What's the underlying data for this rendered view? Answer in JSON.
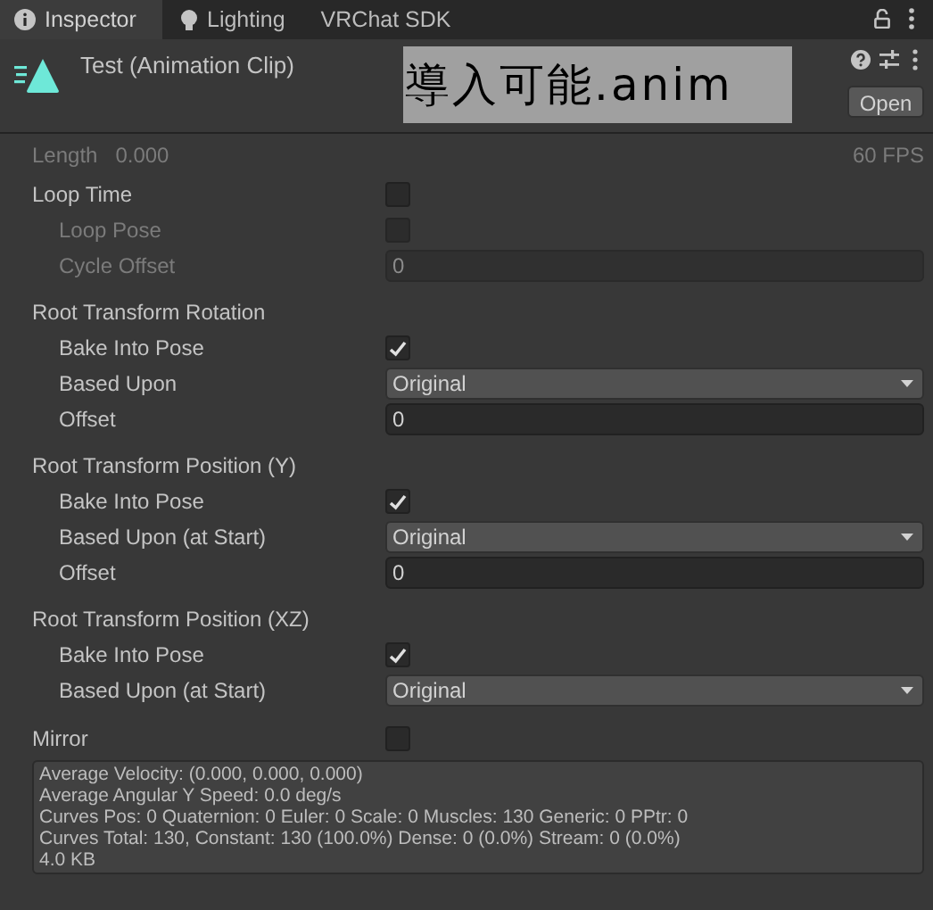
{
  "tabs": [
    {
      "label": "Inspector",
      "selected": true
    },
    {
      "label": "Lighting",
      "selected": false
    },
    {
      "label": "VRChat SDK",
      "selected": false
    }
  ],
  "header": {
    "title": "Test (Animation Clip)",
    "overlay_label": "導入可能.anim",
    "open_button": "Open"
  },
  "length": {
    "label": "Length",
    "value": "0.000",
    "fps": "60 FPS"
  },
  "properties": [
    {
      "kind": "checkbox",
      "label": "Loop Time",
      "checked": false,
      "disabled": false,
      "children": [
        {
          "kind": "checkbox",
          "label": "Loop Pose",
          "checked": false,
          "disabled": true
        },
        {
          "kind": "field",
          "label": "Cycle Offset",
          "value": "0",
          "disabled": true
        }
      ]
    },
    {
      "kind": "group",
      "label": "Root Transform Rotation",
      "disabled": false,
      "children": [
        {
          "kind": "checkbox",
          "label": "Bake Into Pose",
          "checked": true,
          "disabled": false
        },
        {
          "kind": "dropdown",
          "label": "Based Upon",
          "value": "Original",
          "disabled": false
        },
        {
          "kind": "field",
          "label": "Offset",
          "value": "0",
          "disabled": false
        }
      ]
    },
    {
      "kind": "group",
      "label": "Root Transform Position (Y)",
      "disabled": false,
      "children": [
        {
          "kind": "checkbox",
          "label": "Bake Into Pose",
          "checked": true,
          "disabled": false
        },
        {
          "kind": "dropdown",
          "label": "Based Upon (at Start)",
          "value": "Original",
          "disabled": false
        },
        {
          "kind": "field",
          "label": "Offset",
          "value": "0",
          "disabled": false
        }
      ]
    },
    {
      "kind": "group",
      "label": "Root Transform Position (XZ)",
      "disabled": false,
      "children": [
        {
          "kind": "checkbox",
          "label": "Bake Into Pose",
          "checked": true,
          "disabled": false
        },
        {
          "kind": "dropdown",
          "label": "Based Upon (at Start)",
          "value": "Original",
          "disabled": false
        }
      ]
    },
    {
      "kind": "checkbox",
      "label": "Mirror",
      "checked": false,
      "disabled": false
    }
  ],
  "info_lines": [
    "Average Velocity: (0.000, 0.000, 0.000)",
    "Average Angular Y Speed: 0.0 deg/s",
    "Curves Pos: 0 Quaternion: 0 Euler: 0 Scale: 0 Muscles: 130 Generic: 0 PPtr: 0",
    "Curves Total: 130, Constant: 130 (100.0%) Dense: 0 (0.0%) Stream: 0 (0.0%)",
    "4.0 KB"
  ]
}
